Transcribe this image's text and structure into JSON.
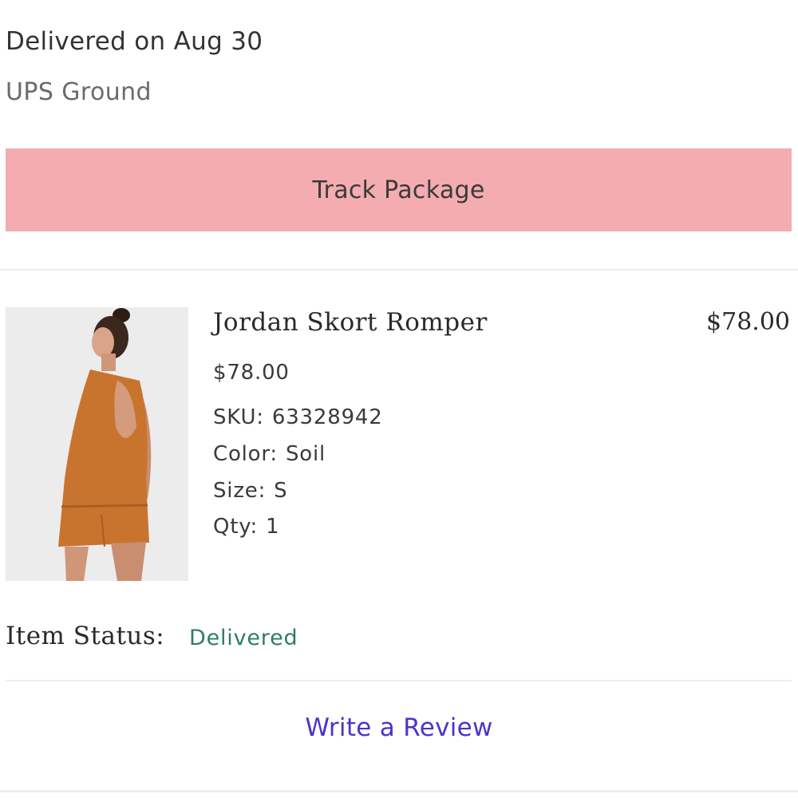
{
  "shipment": {
    "delivery_text": "Delivered on Aug 30",
    "carrier": "UPS Ground",
    "track_button_label": "Track Package",
    "track_button_color": "#f4acb0"
  },
  "item": {
    "image_alt": "Jordan Skort Romper product photo",
    "name": "Jordan Skort Romper",
    "line_total": "$78.00",
    "unit_price": "$78.00",
    "sku_label": "SKU:",
    "sku": "63328942",
    "color_label": "Color:",
    "color": "Soil",
    "size_label": "Size:",
    "size": "S",
    "qty_label": "Qty:",
    "qty": "1",
    "status_label": "Item Status:",
    "status": "Delivered",
    "status_color": "#2e7d62"
  },
  "actions": {
    "write_review_label": "Write a Review",
    "link_color": "#4a35c9"
  }
}
